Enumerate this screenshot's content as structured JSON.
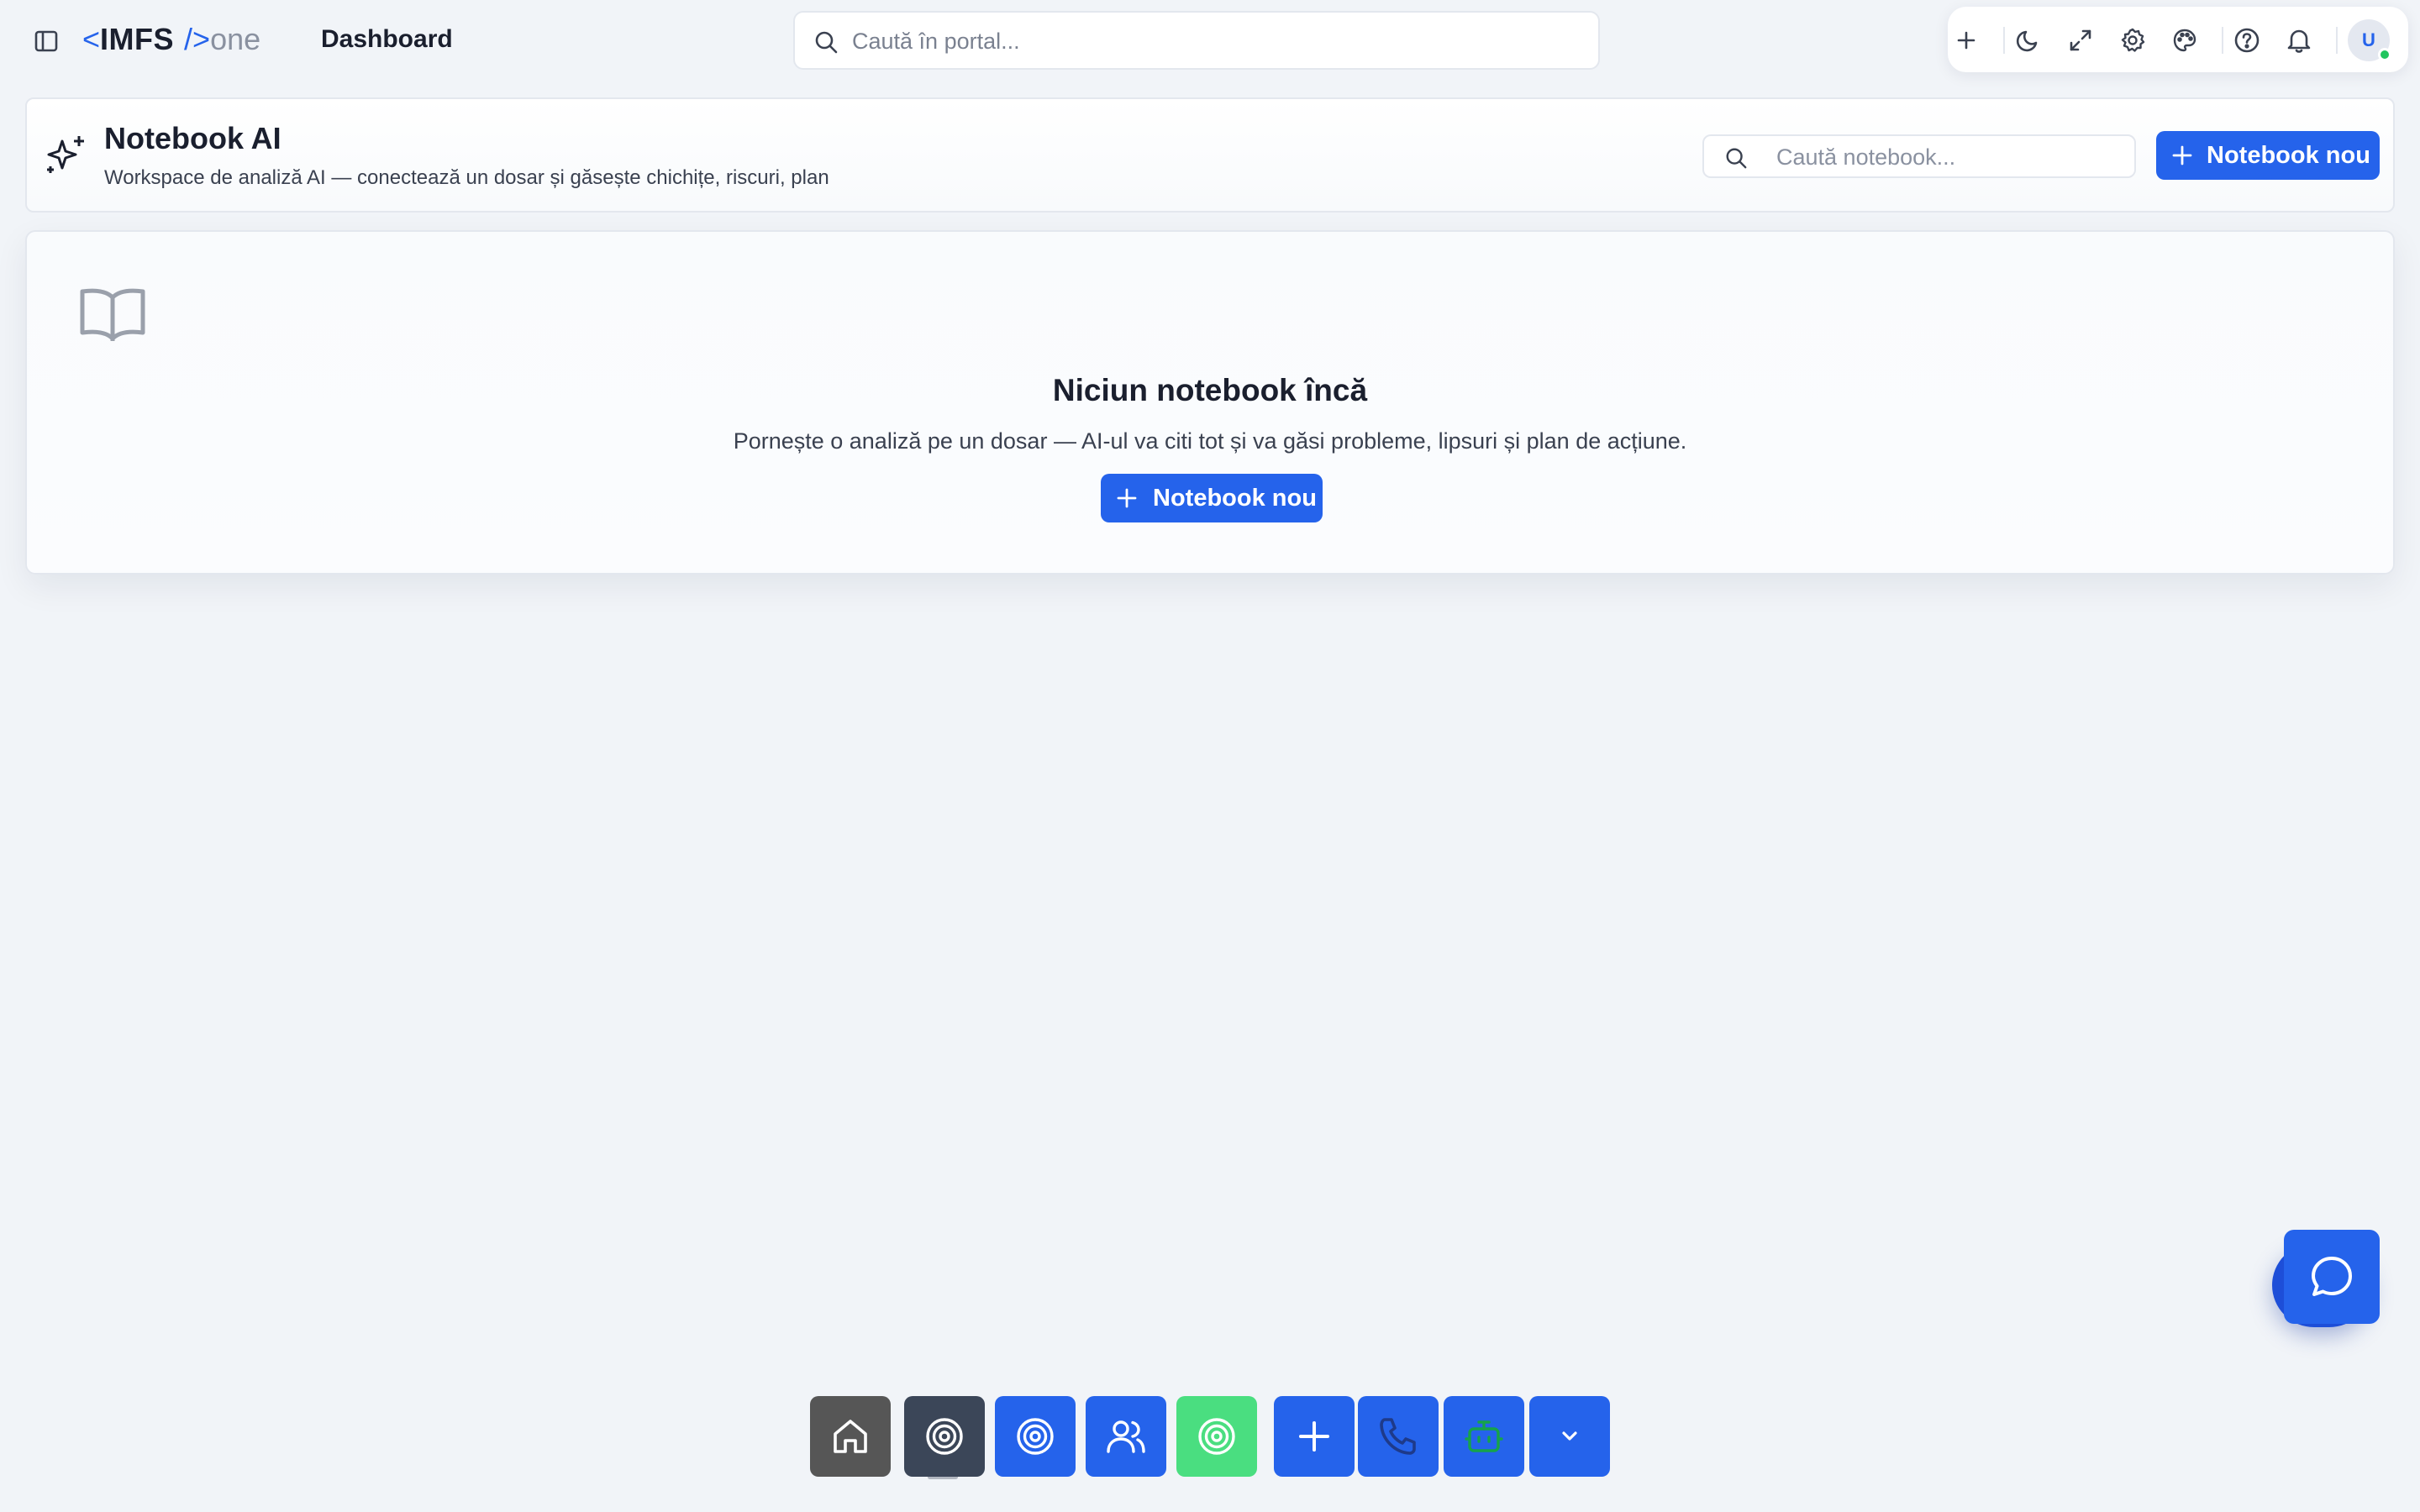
{
  "app": {
    "logo": {
      "open": "<",
      "brand": "IMFS",
      "close": "/>",
      "suffix": "one"
    },
    "page_title": "Dashboard"
  },
  "global_search": {
    "placeholder": "Caută în portal...",
    "value": ""
  },
  "toolbar": {
    "icons": [
      "plus-icon",
      "moon-icon",
      "expand-icon",
      "gear-icon",
      "palette-icon",
      "help-icon",
      "bell-icon"
    ],
    "avatar_initial": "U",
    "status": "online"
  },
  "header": {
    "title": "Notebook AI",
    "subtitle": "Workspace de analiză AI — conectează un dosar și găsește chichițe, riscuri, plan",
    "search_placeholder": "Caută notebook...",
    "new_button_label": "Notebook nou"
  },
  "empty_state": {
    "title": "Niciun notebook încă",
    "description": "Pornește o analiză pe un dosar — AI-ul va citi tot și va găsi probleme, lipsuri și plan de acțiune.",
    "button_label": "Notebook nou"
  },
  "dock": {
    "items": [
      {
        "icon": "home-icon",
        "color": "#565656"
      },
      {
        "icon": "target-icon",
        "color": "#3b4658",
        "active": true
      },
      {
        "icon": "target-icon",
        "color": "#2563eb"
      },
      {
        "icon": "users-icon",
        "color": "#2563eb"
      },
      {
        "icon": "target-icon",
        "color": "#4ade80"
      },
      {
        "icon": "plus-icon",
        "color": "#2563eb"
      },
      {
        "icon": "phone-icon",
        "color": "#2563eb"
      },
      {
        "icon": "robot-icon",
        "color": "#2563eb"
      },
      {
        "icon": "chevron-down-icon",
        "color": "#2563eb"
      }
    ]
  },
  "colors": {
    "accent": "#2563eb",
    "background": "#f1f4f8",
    "text": "#1a1f2e",
    "online": "#22c55e"
  }
}
